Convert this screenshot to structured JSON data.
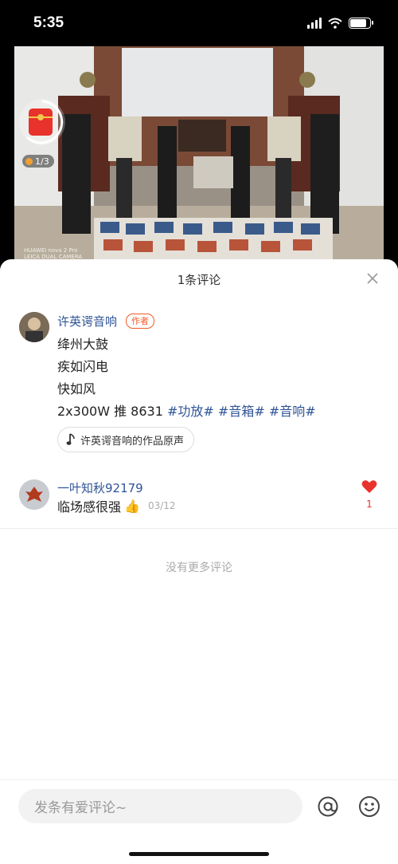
{
  "status": {
    "time": "5:35"
  },
  "post": {
    "page_indicator": "1/3",
    "watermark_line1": "HUAWEI nova 2 Pro",
    "watermark_line2": "LEICA DUAL CAMERA"
  },
  "comments_panel": {
    "title": "1条评论",
    "author_comment": {
      "username": "许英谔音响",
      "author_tag": "作者",
      "lines": [
        "绛州大鼓",
        "疾如闪电",
        "快如风"
      ],
      "last_line_text": "2x300W 推 8631",
      "hashtags": [
        "#功放#",
        "#音箱#",
        "#音响#"
      ],
      "music_label": "许英谔音响的作品原声"
    },
    "comment": {
      "username": "一叶知秋92179",
      "text": "临场感很强",
      "emoji": "👍",
      "date": "03/12",
      "likes": "1"
    },
    "no_more_text": "没有更多评论"
  },
  "input_bar": {
    "placeholder": "发条有爱评论~"
  },
  "colors": {
    "link_blue": "#2f5496",
    "author_tag": "#f25a2a",
    "like_red": "#e8322c"
  }
}
